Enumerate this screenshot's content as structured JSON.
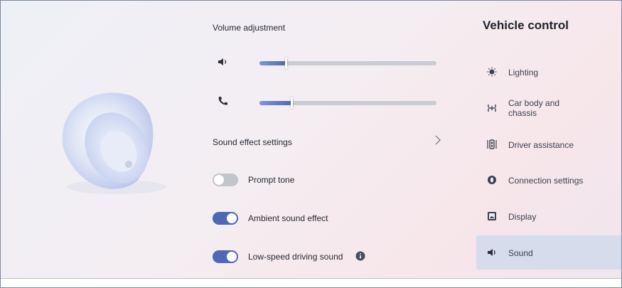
{
  "volume": {
    "title": "Volume adjustment",
    "media_level": 0.15,
    "call_level": 0.18
  },
  "sound_effect": {
    "label": "Sound effect settings"
  },
  "toggles": [
    {
      "label": "Prompt tone",
      "on": false
    },
    {
      "label": "Ambient sound effect",
      "on": true
    },
    {
      "label": "Low-speed driving sound",
      "on": true
    }
  ],
  "nav": {
    "title": "Vehicle control",
    "items": [
      {
        "label": "Lighting",
        "icon": "bulb-icon"
      },
      {
        "label": "Car body and chassis",
        "icon": "chassis-icon"
      },
      {
        "label": "Driver assistance",
        "icon": "driver-assist-icon"
      },
      {
        "label": "Connection settings",
        "icon": "connection-icon"
      },
      {
        "label": "Display",
        "icon": "display-icon"
      },
      {
        "label": "Sound",
        "icon": "speaker-icon",
        "active": true
      }
    ]
  },
  "colors": {
    "accent": "#4e68b3",
    "active_nav_bg": "#d7dcec"
  }
}
